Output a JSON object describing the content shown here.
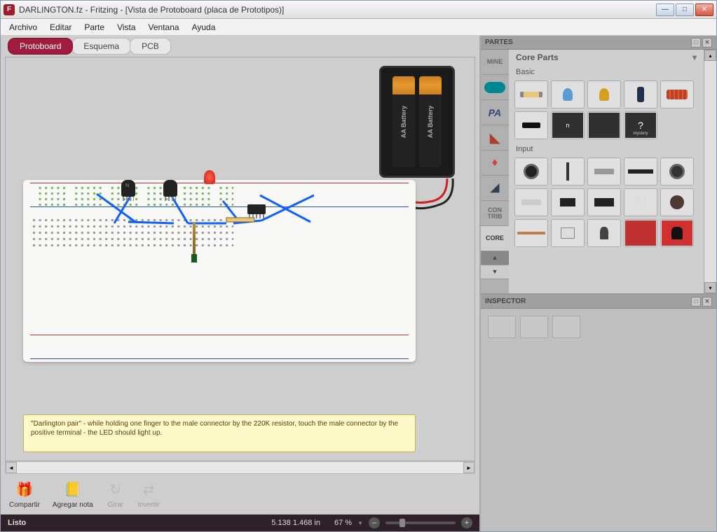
{
  "window": {
    "title": "DARLINGTON.fz - Fritzing - [Vista de Protoboard (placa de Prototipos)]"
  },
  "menu": {
    "archivo": "Archivo",
    "editar": "Editar",
    "parte": "Parte",
    "vista": "Vista",
    "ventana": "Ventana",
    "ayuda": "Ayuda"
  },
  "tabs": {
    "protoboard": "Protoboard",
    "esquema": "Esquema",
    "pcb": "PCB"
  },
  "battery": {
    "label1": "AA Battery",
    "label2": "AA Battery"
  },
  "note": "\"Darlington pair\" - while holding one finger to the male connector by the 220K resistor, touch the male connector by the positive terminal - the LED should light up.",
  "toolbar": {
    "compartir": "Compartir",
    "agregar_nota": "Agregar nota",
    "girar": "Girar",
    "invertir": "Invertir"
  },
  "status": {
    "ready": "Listo",
    "coords": "5.138 1.468 in",
    "zoom": "67 %"
  },
  "partes": {
    "panel_title": "PARTES",
    "bins": {
      "mine": "MINE",
      "arduino": "arduino",
      "pa": "PA",
      "contrib": "CON TRIB",
      "core": "CORE"
    },
    "bin_title": "Core Parts",
    "sections": {
      "basic": "Basic",
      "input": "Input"
    },
    "mystery": "mystery"
  },
  "inspector": {
    "panel_title": "INSPECTOR"
  }
}
